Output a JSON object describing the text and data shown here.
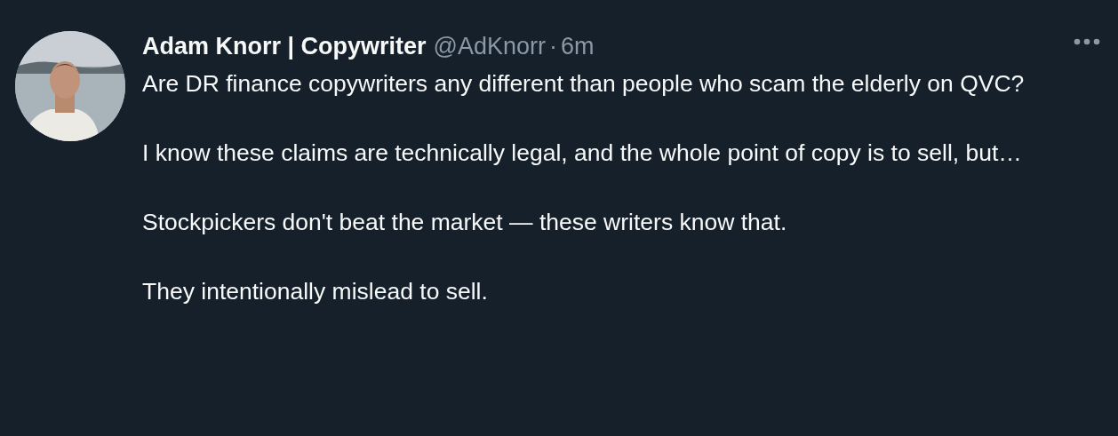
{
  "tweet": {
    "author_name": "Adam Knorr | Copywriter",
    "handle": "@AdKnorr",
    "separator": "·",
    "time": "6m",
    "paragraphs": [
      "Are DR finance copywriters any different than people who scam the elderly on QVC?",
      "I know these claims are technically legal, and the whole point of copy is to sell, but…",
      "Stockpickers don't beat the market — these writers know that.",
      "They intentionally mislead to sell."
    ]
  }
}
